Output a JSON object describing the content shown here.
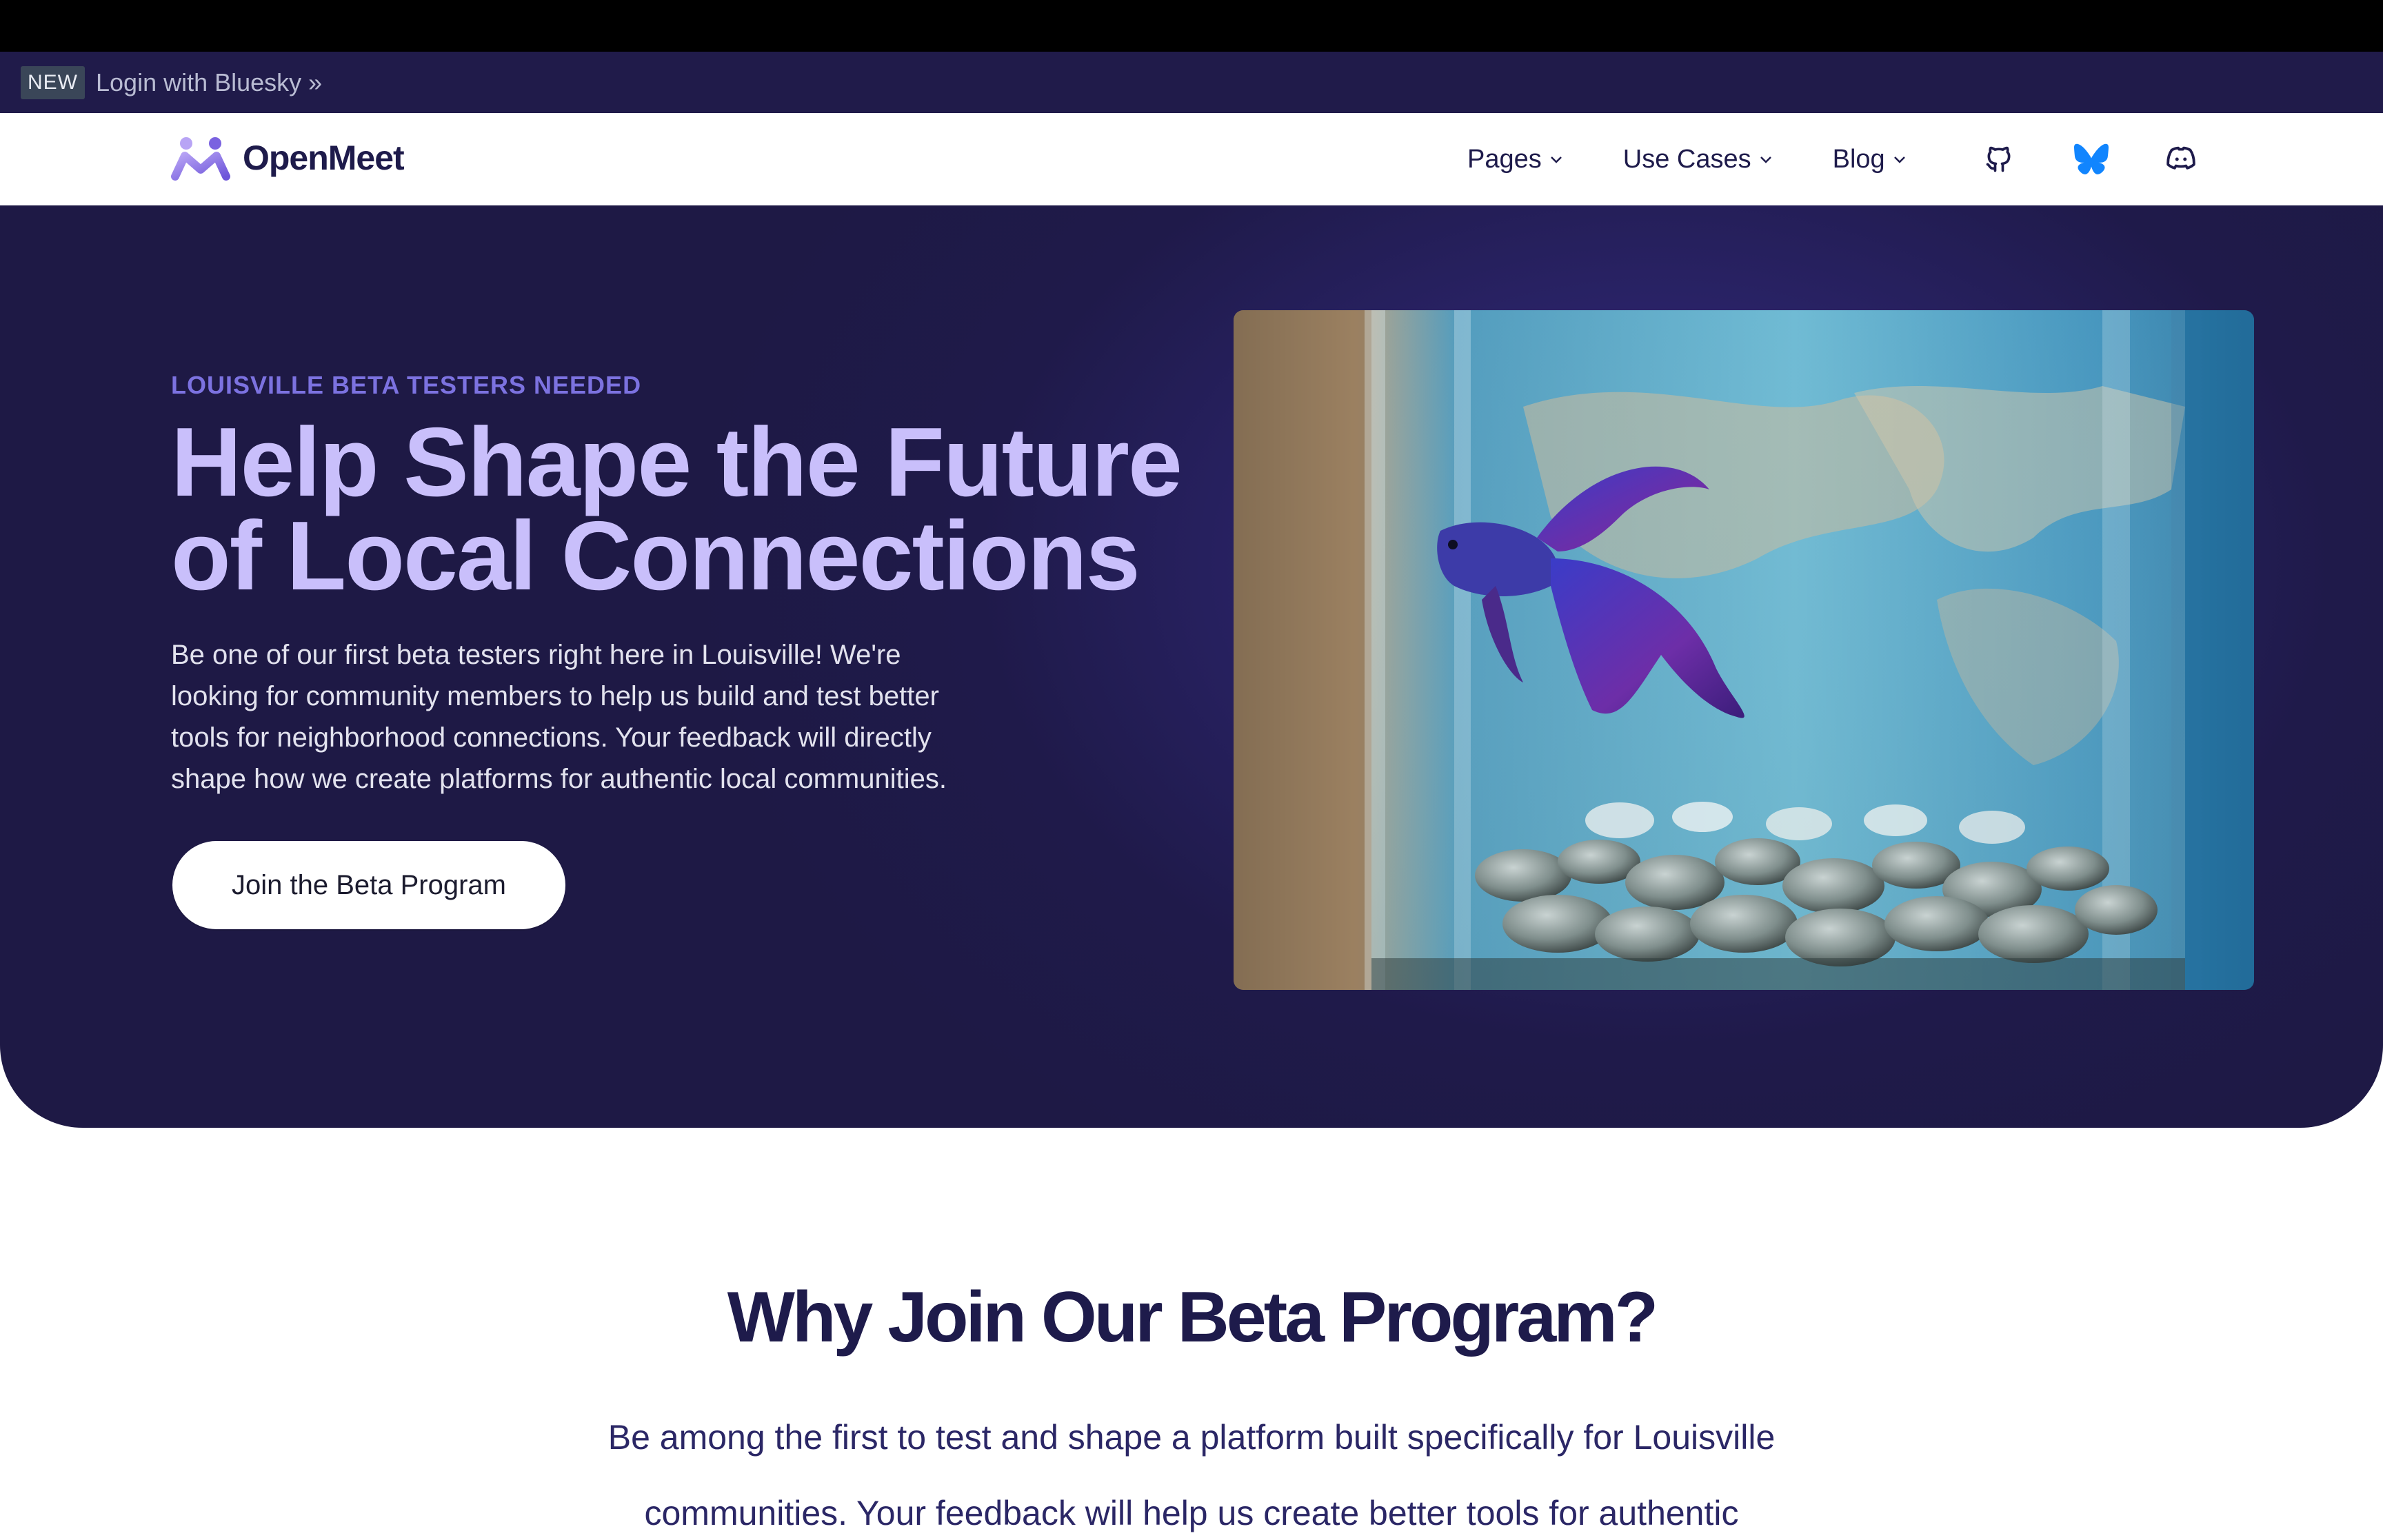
{
  "announcement": {
    "badge": "NEW",
    "link_text": "Login with Bluesky »"
  },
  "nav": {
    "brand": "OpenMeet",
    "items": [
      {
        "label": "Pages"
      },
      {
        "label": "Use Cases"
      },
      {
        "label": "Blog"
      }
    ],
    "icons": [
      "github-icon",
      "bluesky-icon",
      "discord-icon"
    ]
  },
  "hero": {
    "eyebrow": "LOUISVILLE BETA TESTERS NEEDED",
    "headline": "Help Shape the Future of Local Connections",
    "intro": "Be one of our first beta testers right here in Louisville! We're looking for community members to help us build and test better tools for neighborhood connections. Your feedback will directly shape how we create platforms for authentic local communities.",
    "cta_label": "Join the Beta Program"
  },
  "why": {
    "title": "Why Join Our Beta Program?",
    "body": "Be among the first to test and shape a platform built specifically for Louisville communities. Your feedback will help us create better tools for authentic"
  },
  "colors": {
    "hero_bg": "#1f1a4a",
    "headline": "#c9bffb",
    "eyebrow": "#7c72e0",
    "brand_text": "#1e1b4b",
    "bluesky": "#1185fe"
  }
}
